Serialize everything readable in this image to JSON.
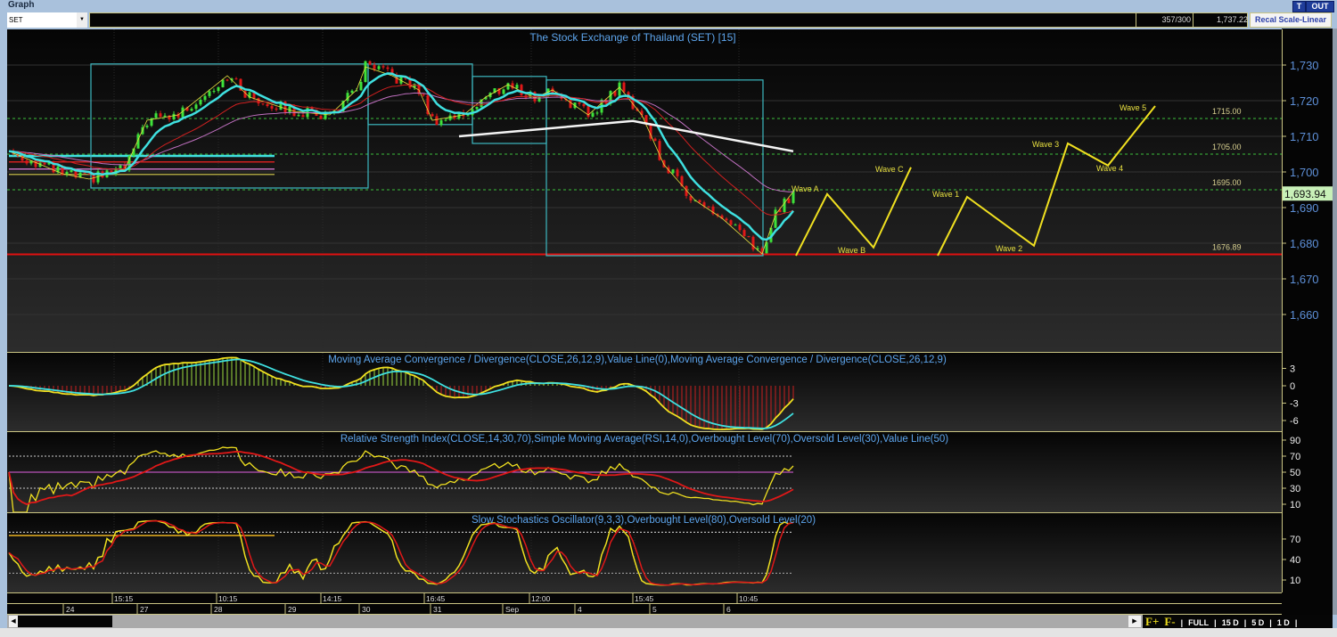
{
  "window": {
    "title": "Graph",
    "t_button": "T",
    "out_button": "OUT"
  },
  "toolbar": {
    "symbol": "SET",
    "bar_count": "357/300",
    "price_readout": "1,737.22",
    "recal_label": "Recal Scale-Linear"
  },
  "colors": {
    "up": "#3ee23a",
    "down": "#e01818",
    "ema_fast": "#3fe0e0",
    "ema_mid": "#d02020",
    "ema_slow": "#c070c0",
    "accent": "#f0e020",
    "level": "#3cc03c",
    "support": "#e01010"
  },
  "chart_data": {
    "type": "line",
    "title": "The Stock Exchange of Thailand (SET) [15]",
    "price_axis": {
      "ticks": [
        "1,730",
        "1,720",
        "1,710",
        "1,700",
        "1,690",
        "1,680",
        "1,670",
        "1,660"
      ],
      "tick_values": [
        1730,
        1720,
        1710,
        1700,
        1690,
        1680,
        1670,
        1660
      ],
      "ylim": [
        1652,
        1740
      ]
    },
    "last_price": "1,693.94",
    "close_anchors": [
      [
        0,
        1705.8
      ],
      [
        12,
        1699.5
      ],
      [
        18,
        1698
      ],
      [
        26,
        1700.8
      ],
      [
        31,
        1714.5
      ],
      [
        38,
        1716
      ],
      [
        49,
        1727
      ],
      [
        54,
        1721
      ],
      [
        64,
        1717
      ],
      [
        72,
        1716
      ],
      [
        78,
        1723
      ],
      [
        80,
        1729.5
      ],
      [
        86,
        1727
      ],
      [
        92,
        1723
      ],
      [
        95,
        1714.5
      ],
      [
        102,
        1716
      ],
      [
        107,
        1721
      ],
      [
        112,
        1724.5
      ],
      [
        118,
        1720.8
      ],
      [
        122,
        1723
      ],
      [
        130,
        1716
      ],
      [
        137,
        1723.8
      ],
      [
        142,
        1716
      ],
      [
        147,
        1702
      ],
      [
        154,
        1692
      ],
      [
        160,
        1687
      ],
      [
        169,
        1677
      ],
      [
        172,
        1688
      ],
      [
        176,
        1694.5
      ]
    ],
    "long_ma": [
      [
        101,
        1710
      ],
      [
        140,
        1714.3
      ],
      [
        176,
        1705.8
      ]
    ],
    "levels": [
      {
        "value": 1715,
        "label": "1715.00",
        "style": "dotted"
      },
      {
        "value": 1705,
        "label": "1705.00",
        "style": "dotted"
      },
      {
        "value": 1695,
        "label": "1695.00",
        "style": "dotted"
      },
      {
        "value": 1676.89,
        "label": "1676.89",
        "style": "solid"
      }
    ],
    "left_lines": [
      1704.5,
      1702.8,
      1700.8,
      1699.3
    ],
    "boxes": [
      [
        18.4,
        1730.3,
        80.6,
        1695.5
      ],
      [
        80.6,
        1730.3,
        104,
        1713.3
      ],
      [
        104,
        1726.8,
        120.6,
        1708
      ],
      [
        120.6,
        1725.8,
        169.2,
        1676.5
      ]
    ],
    "waves": [
      {
        "points": [
          [
            176.6,
            1676.5
          ],
          [
            183.6,
            1693.8
          ],
          [
            194,
            1678.8
          ],
          [
            202.4,
            1701.3
          ]
        ]
      },
      {
        "points": [
          [
            208.4,
            1676.5
          ],
          [
            215,
            1693
          ],
          [
            230,
            1679.3
          ],
          [
            237.6,
            1708
          ],
          [
            246.6,
            1701.8
          ],
          [
            257.2,
            1718.5
          ]
        ]
      }
    ],
    "wave_labels": [
      {
        "text": "Wave A",
        "at": [
          175.6,
          1694.5
        ]
      },
      {
        "text": "Wave B",
        "at": [
          186,
          1677.3
        ]
      },
      {
        "text": "Wave C",
        "at": [
          194.4,
          1700
        ]
      },
      {
        "text": "Wave 1",
        "at": [
          207.2,
          1693
        ]
      },
      {
        "text": "Wave 2",
        "at": [
          221.4,
          1677.8
        ]
      },
      {
        "text": "Wave 3",
        "at": [
          229.6,
          1707
        ]
      },
      {
        "text": "Wave 4",
        "at": [
          244,
          1700.3
        ]
      },
      {
        "text": "Wave 5",
        "at": [
          249.2,
          1717.3
        ]
      }
    ],
    "macd": {
      "title": "Moving Average Convergence / Divergence(CLOSE,26,12,9),Value Line(0),Moving Average Convergence / Divergence(CLOSE,26,12,9)",
      "ticks": [
        "3",
        "0",
        "-3",
        "-6"
      ],
      "tick_values": [
        3,
        0,
        -3,
        -6
      ]
    },
    "rsi": {
      "title": "Relative Strength Index(CLOSE,14,30,70),Simple Moving Average(RSI,14,0),Overbought Level(70),Oversold Level(30),Value Line(50)",
      "ticks": [
        "90",
        "70",
        "50",
        "30",
        "10"
      ],
      "tick_values": [
        90,
        70,
        50,
        30,
        10
      ]
    },
    "stoch": {
      "title": "Slow Stochastics Oscillator(9,3,3),Overbought Level(80),Oversold Level(20)",
      "ticks": [
        "70",
        "40",
        "10"
      ],
      "tick_values": [
        70,
        40,
        10
      ]
    },
    "time_labels": [
      "15:15",
      "10:15",
      "14:15",
      "16:45",
      "12:00",
      "15:45",
      "10:45"
    ],
    "date_labels": [
      "24",
      "27",
      "28",
      "29",
      "30",
      "31",
      "Sep",
      "4",
      "5",
      "6"
    ]
  },
  "zoom_bar": {
    "f_plus": "F+",
    "f_minus": "F-",
    "full": "FULL",
    "d15": "15 D",
    "d5": "5 D",
    "d1": "1 D",
    "sep": "|"
  }
}
